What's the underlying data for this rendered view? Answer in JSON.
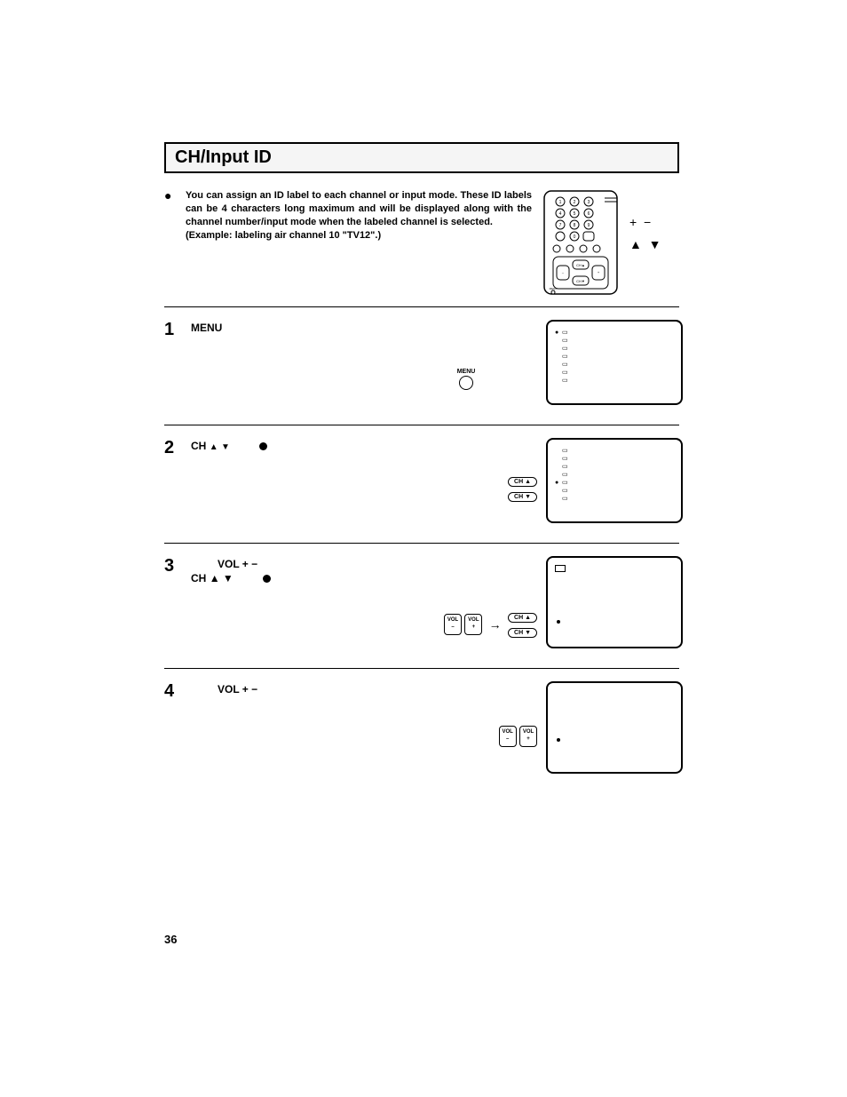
{
  "title": "CH/Input ID",
  "intro": "You can assign an ID label to each channel or input mode. These ID labels can be 4 characters long maximum and will be displayed along with the channel number/input mode when the labeled channel is selected.",
  "intro_example": "(Example: labeling air channel 10 \"TV12\".)",
  "legend": {
    "plus": "+",
    "minus": "−",
    "up": "▲",
    "down": "▼"
  },
  "steps": [
    {
      "num": "1",
      "heading": "MENU"
    },
    {
      "num": "2",
      "heading_prefix": "CH",
      "up": "▲",
      "down": "▼"
    },
    {
      "num": "3",
      "heading_prefix": "VOL",
      "plus": "+",
      "minus": "−",
      "sub_prefix": "CH",
      "sub_up": "▲",
      "sub_down": "▼"
    },
    {
      "num": "4",
      "heading_prefix": "VOL",
      "plus": "+",
      "minus": "−"
    }
  ],
  "remote_labels": {
    "menu": "MENU",
    "ch_up": "CH ▲",
    "ch_down": "CH ▼",
    "vol": "VOL",
    "vol_plus": "+",
    "vol_minus": "–"
  },
  "page_number": "36"
}
